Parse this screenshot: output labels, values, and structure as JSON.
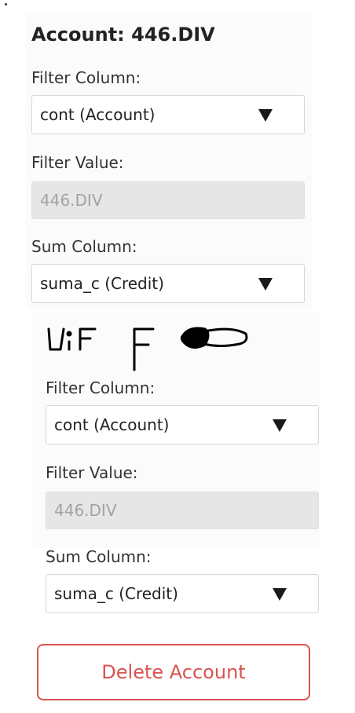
{
  "section1": {
    "title": "Account: 446.DIV",
    "filter_column_label": "Filter Column:",
    "filter_column_value": "cont (Account)",
    "filter_value_label": "Filter Value:",
    "filter_value_value": "446.DIV",
    "sum_column_label": "Sum Column:",
    "sum_column_value": "suma_c (Credit)"
  },
  "section2": {
    "filter_column_label": "Filter Column:",
    "filter_column_value": "cont (Account)",
    "filter_value_label": "Filter Value:",
    "filter_value_value": "446.DIV",
    "sum_column_label": "Sum Column:",
    "sum_column_value": "suma_c (Credit)"
  },
  "delete_button_label": "Delete Account",
  "colors": {
    "danger": "#d9534f",
    "disabled_bg": "#e6e6e6",
    "disabled_text": "#a3a3a3"
  }
}
